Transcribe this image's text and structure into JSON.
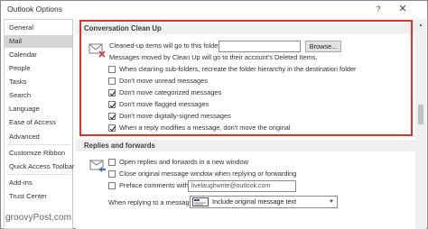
{
  "window": {
    "title": "Outlook Options",
    "help_glyph": "?",
    "close_glyph": "✕"
  },
  "sidebar": {
    "items": [
      {
        "label": "General"
      },
      {
        "label": "Mail",
        "selected": true
      },
      {
        "label": "Calendar"
      },
      {
        "label": "People"
      },
      {
        "label": "Tasks"
      },
      {
        "label": "Search"
      },
      {
        "label": "Language"
      },
      {
        "label": "Ease of Access"
      },
      {
        "label": "Advanced"
      },
      {
        "label": "Customize Ribbon"
      },
      {
        "label": "Quick Access Toolbar"
      },
      {
        "label": "Add-ins"
      },
      {
        "label": "Trust Center"
      }
    ]
  },
  "cleanup": {
    "heading": "Conversation Clean Up",
    "folder_label": "Cleaned-up items will go to this folder:",
    "folder_value": "",
    "browse_label": "Browse...",
    "deleted_note": "Messages moved by Clean Up will go to their account's Deleted Items.",
    "options": [
      {
        "label": "When cleaning sub-folders, recreate the folder hierarchy in the destination folder",
        "checked": false
      },
      {
        "label": "Don't move unread messages",
        "checked": false
      },
      {
        "label": "Don't move categorized messages",
        "checked": true
      },
      {
        "label": "Don't move flagged messages",
        "checked": true
      },
      {
        "label": "Don't move digitally-signed messages",
        "checked": true
      },
      {
        "label": "When a reply modifies a message, don't move the original",
        "checked": true
      }
    ]
  },
  "replies": {
    "heading": "Replies and forwards",
    "options": [
      {
        "label": "Open replies and forwards in a new window",
        "checked": false
      },
      {
        "label": "Close original message window when replying or forwarding",
        "checked": false
      }
    ],
    "preface_label": "Preface comments with:",
    "preface_checked": false,
    "preface_value": "livelaughwrite@outlook.com",
    "replying_label": "When replying to a message:",
    "replying_value": "Include original message text"
  },
  "watermark": "groovyPost.com",
  "colors": {
    "highlight": "#e2312b",
    "selected_nav": "#d5d5d5",
    "section_header": "#f0f0f0"
  }
}
